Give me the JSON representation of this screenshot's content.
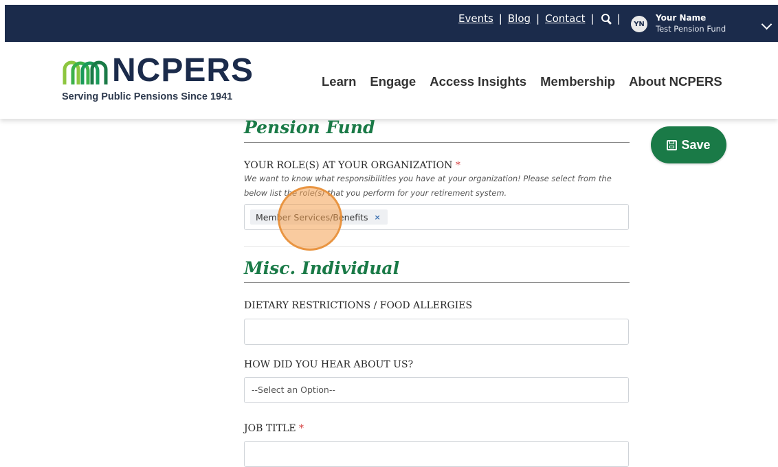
{
  "topbar": {
    "links": [
      "Events",
      "Blog",
      "Contact"
    ],
    "separator": "|",
    "search_icon": "search-icon",
    "user": {
      "initials": "YN",
      "name": "Your Name",
      "org": "Test Pension Fund"
    },
    "menu_icon": "chevron-down-icon",
    "background": "#1b2b4b"
  },
  "header": {
    "logo_text": "NCPERS",
    "tagline": "Serving Public Pensions Since 1941",
    "nav": [
      "Learn",
      "Engage",
      "Access Insights",
      "Membership",
      "About NCPERS"
    ]
  },
  "save_button": {
    "label": "Save",
    "icon": "floppy-disk-icon",
    "color": "#1a7a47"
  },
  "sections": {
    "pension_fund": {
      "title": "Pension Fund",
      "roles_label": "YOUR ROLE(S) AT YOUR ORGANIZATION",
      "required_mark": "*",
      "roles_help": "We want to know what responsibilities you have at your organization! Please select from the below list the role(s) that you perform for your retirement system.",
      "selected_roles": [
        {
          "label": "Member Services/Benefits",
          "remove": "×"
        }
      ]
    },
    "misc_individual": {
      "title": "Misc. Individual",
      "dietary_label": "DIETARY RESTRICTIONS / FOOD ALLERGIES",
      "dietary_value": "",
      "hear_label": "HOW DID YOU HEAR ABOUT US?",
      "hear_selected": "--Select an Option--",
      "job_title_label": "JOB TITLE",
      "job_title_required": "*"
    }
  },
  "accent_green": "#1a7a47"
}
